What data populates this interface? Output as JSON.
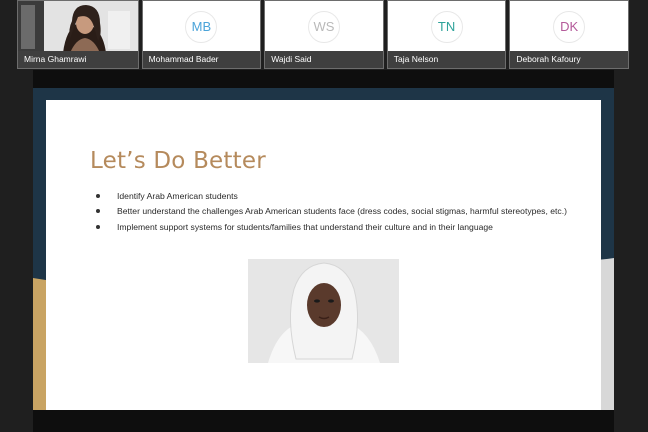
{
  "participants": [
    {
      "name": "Mirna Ghamrawi",
      "initials": ""
    },
    {
      "name": "Mohammad Bader",
      "initials": "MB",
      "color": "#4aa3d9"
    },
    {
      "name": "Wajdi Said",
      "initials": "WS",
      "color": "#b9b9b9"
    },
    {
      "name": "Taja Nelson",
      "initials": "TN",
      "color": "#2fa39a"
    },
    {
      "name": "Deborah Kafoury",
      "initials": "DK",
      "color": "#b45a9a"
    }
  ],
  "slide": {
    "title": "Let’s Do Better",
    "bullets": [
      "Identify Arab American students",
      "Better understand the challenges Arab American students face (dress codes, social stigmas, harmful stereotypes, etc.)",
      "Implement support systems for students/families that understand their culture and in their language"
    ],
    "colors": {
      "title": "#b58a5c",
      "navy": "#1e3547",
      "gold": "#c9a463",
      "gray": "#d8d8d8"
    }
  }
}
